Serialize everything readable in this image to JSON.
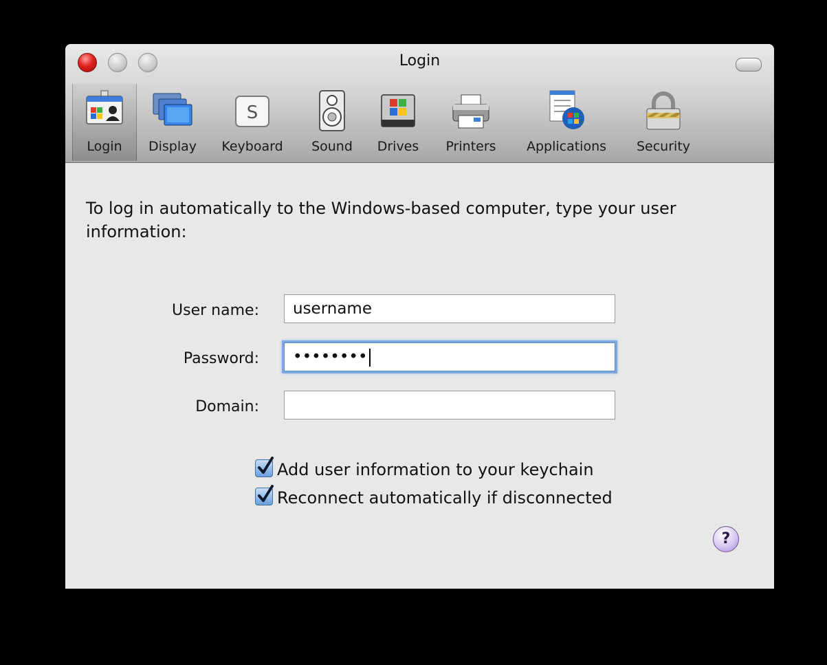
{
  "window": {
    "title": "Login"
  },
  "toolbar": {
    "items": [
      {
        "label": "Login",
        "icon": "login-card-icon",
        "selected": true
      },
      {
        "label": "Display",
        "icon": "display-icon"
      },
      {
        "label": "Keyboard",
        "icon": "keyboard-key-icon",
        "key": "S"
      },
      {
        "label": "Sound",
        "icon": "speaker-icon"
      },
      {
        "label": "Drives",
        "icon": "drive-icon"
      },
      {
        "label": "Printers",
        "icon": "printer-icon"
      },
      {
        "label": "Applications",
        "icon": "applications-icon"
      },
      {
        "label": "Security",
        "icon": "padlock-icon"
      }
    ]
  },
  "main": {
    "intro": "To log in automatically to the Windows-based computer, type your user information:",
    "fields": {
      "username": {
        "label": "User name:",
        "value": "username"
      },
      "password": {
        "label": "Password:",
        "value": "••••••••"
      },
      "domain": {
        "label": "Domain:",
        "value": ""
      }
    },
    "checkboxes": [
      {
        "label": "Add user information to your keychain",
        "checked": true
      },
      {
        "label": "Reconnect automatically if disconnected",
        "checked": true
      }
    ],
    "help_label": "?"
  }
}
